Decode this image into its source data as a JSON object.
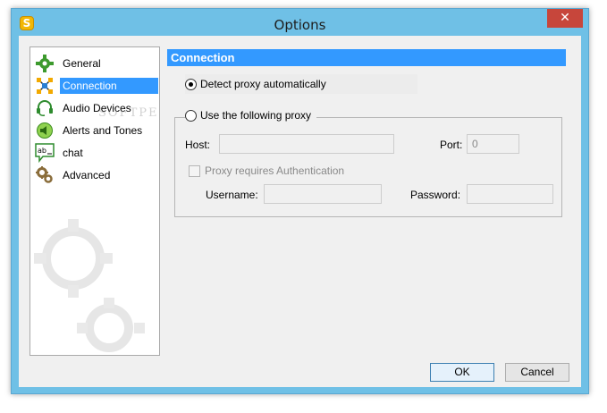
{
  "window": {
    "title": "Options",
    "app_icon_letter": "S",
    "close_glyph": "✕"
  },
  "sidebar": {
    "items": [
      {
        "label": "General",
        "icon": "gear-icon"
      },
      {
        "label": "Connection",
        "icon": "network-icon",
        "selected": true
      },
      {
        "label": "Audio Devices",
        "icon": "headset-icon"
      },
      {
        "label": "Alerts and Tones",
        "icon": "speaker-icon"
      },
      {
        "label": "chat",
        "icon": "chat-icon"
      },
      {
        "label": "Advanced",
        "icon": "gears-icon"
      }
    ],
    "watermark": "SOFTPEDIA"
  },
  "connection": {
    "header": "Connection",
    "detect_proxy_label": "Detect proxy automatically",
    "detect_proxy_checked": true,
    "use_proxy_label": "Use the following proxy",
    "use_proxy_checked": false,
    "host_label": "Host:",
    "host_value": "",
    "port_label": "Port:",
    "port_value": "0",
    "auth_label": "Proxy requires Authentication",
    "auth_checked": false,
    "username_label": "Username:",
    "username_value": "",
    "password_label": "Password:",
    "password_value": ""
  },
  "buttons": {
    "ok": "OK",
    "cancel": "Cancel"
  },
  "colors": {
    "selection": "#3399ff",
    "window_frame": "#6fc0e6",
    "close_button": "#c7463b"
  }
}
